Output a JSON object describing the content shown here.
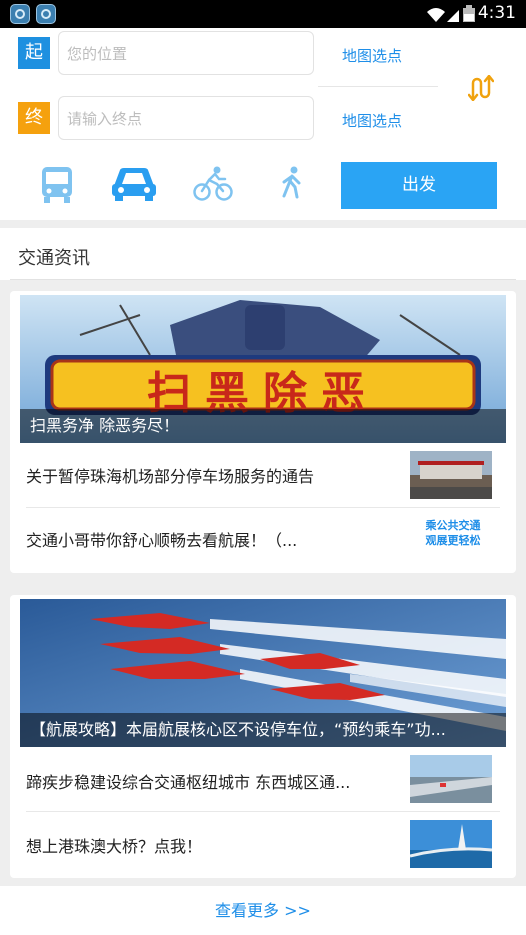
{
  "status_bar": {
    "time": "4:31"
  },
  "route": {
    "start_tag": "起",
    "start_placeholder": "您的位置",
    "start_map_link": "地图选点",
    "end_tag": "终",
    "end_placeholder": "请输入终点",
    "end_map_link": "地图选点",
    "go_button": "出发",
    "modes": [
      "bus-icon",
      "car-icon",
      "bike-icon",
      "walk-icon"
    ],
    "active_mode": "car"
  },
  "news": {
    "section_title": "交通资讯",
    "card1": {
      "banner_title": "扫黑除恶",
      "banner_caption": "扫黑务净 除恶务尽！",
      "items": [
        {
          "title": "关于暂停珠海机场部分停车场服务的通告"
        },
        {
          "title": "交通小哥带你舒心顺畅去看航展！（...",
          "thumb_text_1": "乘公共交通",
          "thumb_text_2": "观展更轻松"
        }
      ]
    },
    "card2": {
      "banner_caption": "【航展攻略】本届航展核心区不设停车位，“预约乘车”功...",
      "items": [
        {
          "title": "蹄疾步稳建设综合交通枢纽城市 东西城区通..."
        },
        {
          "title": "想上港珠澳大桥？点我！"
        }
      ]
    },
    "more_link": "查看更多 >>"
  },
  "colors": {
    "accent": "#2aa4f4",
    "start": "#1e90e0",
    "end": "#f5a10e",
    "link": "#1e8ee8"
  }
}
